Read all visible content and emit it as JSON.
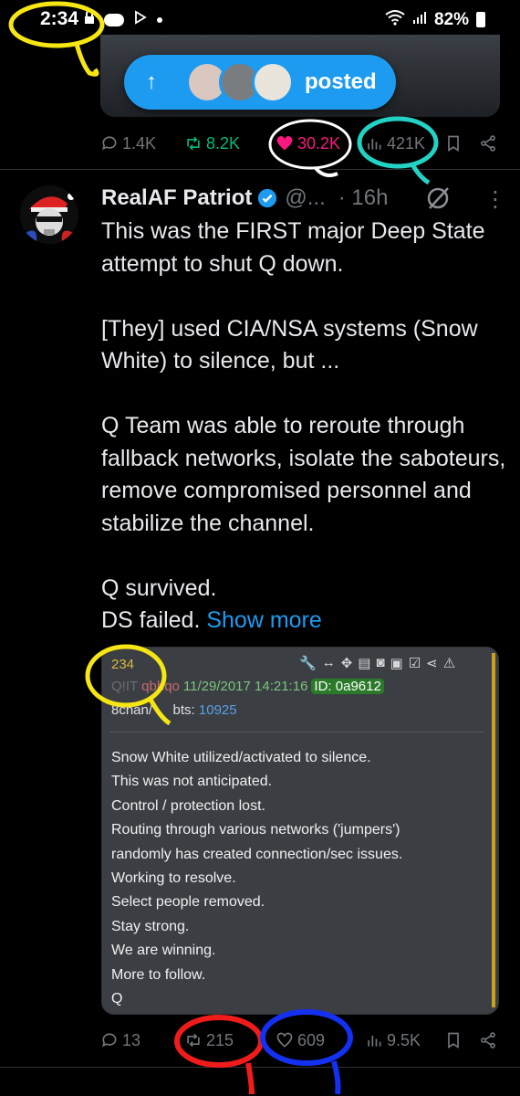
{
  "status_bar": {
    "time": "2:34",
    "battery": "82%"
  },
  "posted_pill": {
    "label": "posted"
  },
  "prev_tweet_actions": {
    "replies": "1.4K",
    "retweets": "8.2K",
    "likes": "30.2K",
    "views": "421K"
  },
  "tweet": {
    "name": "RealAF Patriot",
    "handle": "@...",
    "time": "· 16h",
    "avatar_label": "REALAF",
    "body": {
      "p1": "This was the FIRST major Deep State attempt to shut Q down.",
      "p2": "[They] used CIA/NSA systems (Snow White) to silence, but ...",
      "p3": "Q Team was able to reroute through fallback networks, isolate the saboteurs, remove compromised personnel and stabilize the channel.",
      "p4a": "Q survived.",
      "p4b": "DS failed.",
      "show_more": "Show more"
    },
    "actions": {
      "replies": "13",
      "retweets": "215",
      "likes": "609",
      "views": "9.5K"
    }
  },
  "q_post": {
    "number": "234",
    "name_partial": "Q!IT",
    "trip_partial": "qbhqo",
    "datetime": "11/29/2017 14:21:16",
    "id": "ID: 0a9612",
    "board_prefix": "8chan/",
    "board_suffix": "bts:",
    "post_num": "10925",
    "lines": [
      "Snow White utilized/activated to silence.",
      "This was not anticipated.",
      "Control / protection lost.",
      "Routing through various networks ('jumpers')",
      "randomly has created connection/sec issues.",
      "Working to resolve.",
      "Select people removed.",
      "Stay strong.",
      "We are winning.",
      "More to follow.",
      "Q"
    ]
  },
  "colors": {
    "accent_blue": "#1d9bf0",
    "like_pink": "#f91880",
    "retweet_green": "#00ba7c",
    "muted": "#71767b",
    "annotation_yellow": "#f5e614",
    "annotation_teal": "#22d3c5",
    "annotation_red": "#f01c1c",
    "annotation_blue": "#1430f0"
  },
  "icons": [
    "lock-icon",
    "app-icon",
    "play-store-icon",
    "wifi-icon",
    "signal-icon",
    "battery-icon",
    "arrow-up-icon",
    "reply-icon",
    "retweet-icon",
    "heart-icon",
    "views-icon",
    "bookmark-icon",
    "share-icon",
    "verified-icon",
    "grok-icon",
    "more-icon"
  ]
}
